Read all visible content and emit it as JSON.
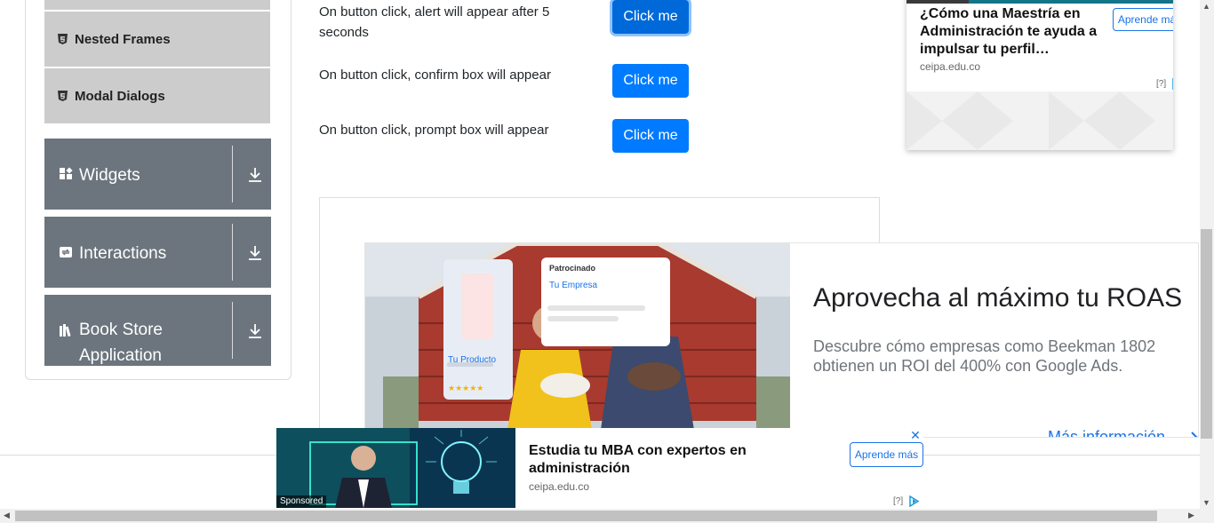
{
  "sidebar": {
    "sub_items": [
      {
        "label": "Nested Frames",
        "icon": "frame-icon"
      },
      {
        "label": "Modal Dialogs",
        "icon": "frame-icon"
      }
    ],
    "groups": [
      {
        "label": "Widgets",
        "icon": "widgets-icon"
      },
      {
        "label": "Interactions",
        "icon": "interactions-icon"
      },
      {
        "label": "Book Store Application",
        "icon": "bookstore-icon"
      }
    ]
  },
  "alerts": [
    {
      "text": "On button click, alert will appear after 5 seconds",
      "button": "Click me"
    },
    {
      "text": "On button click, confirm box will appear",
      "button": "Click me"
    },
    {
      "text": "On button click, prompt box will appear",
      "button": "Click me"
    }
  ],
  "ad_top_right": {
    "title": "¿Cómo una Maestría en Administración te ayuda a impulsar tu perfil…",
    "domain": "ceipa.edu.co",
    "cta": "Aprende más",
    "adchoice": "[?]"
  },
  "ad_big": {
    "headline": "Aprovecha al máximo tu ROAS",
    "body": "Descubre cómo empresas como Beekman 1802 obtienen un ROI del 400% con Google Ads.",
    "cta": "Más información",
    "card_sponsored": "Patrocinado",
    "card_company": "Tu Empresa",
    "card_product": "Tu Producto",
    "card_stars": "★★★★★"
  },
  "ad_bottom": {
    "title": "Estudia tu MBA con expertos en administración",
    "domain": "ceipa.edu.co",
    "cta": "Aprende más",
    "sponsored": "Sponsored",
    "adchoice": "[?]",
    "close": "✕"
  },
  "colors": {
    "primary": "#007bff",
    "sidebar_group": "#6c757d",
    "sidebar_sub": "#cccccc",
    "ad_link": "#1a73e8"
  }
}
